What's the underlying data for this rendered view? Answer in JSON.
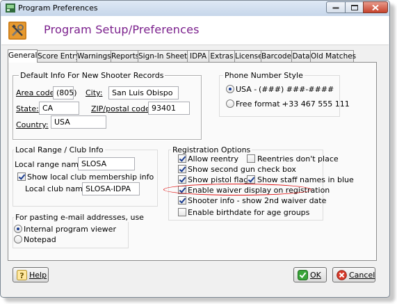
{
  "window": {
    "title": "Program Preferences"
  },
  "header": {
    "title": "Program Setup/Preferences"
  },
  "tabs": [
    "General",
    "Score Entry",
    "Warnings",
    "Reports",
    "Sign-In Sheets",
    "IDPA",
    "Extras",
    "License",
    "Barcode",
    "Data",
    "Old Matches"
  ],
  "default_info": {
    "legend": "Default Info For New Shooter Records",
    "area_code_label": "Area code:",
    "area_code": "(805)",
    "city_label": "City:",
    "city": "San Luis Obispo",
    "state_label": "State:",
    "state": "CA",
    "zip_label": "ZIP/postal code",
    "zip": "93401",
    "country_label": "Country:",
    "country": "USA"
  },
  "phone_style": {
    "legend": "Phone Number Style",
    "usa_label": "USA -",
    "usa_format": "(###) ###-####",
    "free_label": "Free format -",
    "free_example": "+33 467 555 111",
    "selected": "USA"
  },
  "local_range": {
    "legend": "Local Range / Club Info",
    "range_name_label": "Local range name:",
    "range_name": "SLOSA",
    "show_membership_label": "Show local club membership info",
    "show_membership": true,
    "club_name_label": "Local club name:",
    "club_name": "SLOSA-IDPA"
  },
  "registration": {
    "legend": "Registration Options",
    "options": [
      {
        "label": "Allow reentry",
        "checked": true
      },
      {
        "label": "Reentries don't place",
        "checked": false
      },
      {
        "label": "Show second gun check box",
        "checked": true
      },
      {
        "label": "Show pistol flag",
        "checked": true
      },
      {
        "label": "Show staff names in blue",
        "checked": true
      },
      {
        "label": "Enable waiver display on registration",
        "checked": true
      },
      {
        "label": "Shooter info - show 2nd waiver date",
        "checked": true
      },
      {
        "label": "Enable birthdate for age groups",
        "checked": false
      }
    ]
  },
  "email": {
    "legend": "For pasting e-mail addresses, use",
    "internal_label": "Internal program viewer",
    "notepad_label": "Notepad",
    "selected": "Internal program viewer"
  },
  "buttons": {
    "help": "Help",
    "ok": "OK",
    "cancel": "Cancel"
  },
  "colors": {
    "header_title": "#7a1f8c",
    "highlight": "#e01010",
    "check": "#1b3d91"
  }
}
